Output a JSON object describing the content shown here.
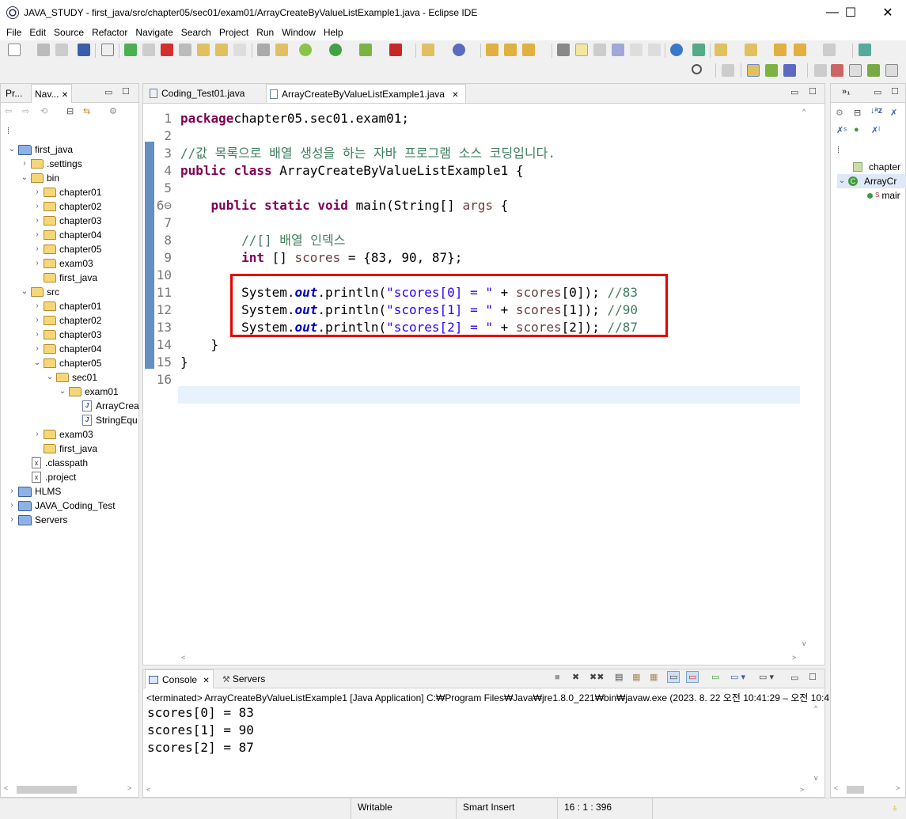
{
  "window": {
    "title": "JAVA_STUDY - first_java/src/chapter05/sec01/exam01/ArrayCreateByValueListExample1.java - Eclipse IDE",
    "minimize": "—",
    "maximize": "☐",
    "close": "✕"
  },
  "menu": [
    "File",
    "Edit",
    "Source",
    "Refactor",
    "Navigate",
    "Search",
    "Project",
    "Run",
    "Window",
    "Help"
  ],
  "nav_panel": {
    "tabs": [
      {
        "label": "Pr..."
      },
      {
        "label": "Nav..."
      }
    ],
    "tree": [
      {
        "label": "first_java",
        "depth": 0,
        "expanded": true,
        "kind": "project"
      },
      {
        "label": ".settings",
        "depth": 1,
        "expanded": false,
        "kind": "folder"
      },
      {
        "label": "bin",
        "depth": 1,
        "expanded": true,
        "kind": "folder"
      },
      {
        "label": "chapter01",
        "depth": 2,
        "expanded": false,
        "kind": "folder"
      },
      {
        "label": "chapter02",
        "depth": 2,
        "expanded": false,
        "kind": "folder"
      },
      {
        "label": "chapter03",
        "depth": 2,
        "expanded": false,
        "kind": "folder"
      },
      {
        "label": "chapter04",
        "depth": 2,
        "expanded": false,
        "kind": "folder"
      },
      {
        "label": "chapter05",
        "depth": 2,
        "expanded": false,
        "kind": "folder"
      },
      {
        "label": "exam03",
        "depth": 2,
        "expanded": false,
        "kind": "folder"
      },
      {
        "label": "first_java",
        "depth": 2,
        "expanded": null,
        "kind": "folder"
      },
      {
        "label": "src",
        "depth": 1,
        "expanded": true,
        "kind": "folder"
      },
      {
        "label": "chapter01",
        "depth": 2,
        "expanded": false,
        "kind": "folder"
      },
      {
        "label": "chapter02",
        "depth": 2,
        "expanded": false,
        "kind": "folder"
      },
      {
        "label": "chapter03",
        "depth": 2,
        "expanded": false,
        "kind": "folder"
      },
      {
        "label": "chapter04",
        "depth": 2,
        "expanded": false,
        "kind": "folder"
      },
      {
        "label": "chapter05",
        "depth": 2,
        "expanded": true,
        "kind": "folder"
      },
      {
        "label": "sec01",
        "depth": 3,
        "expanded": true,
        "kind": "folder"
      },
      {
        "label": "exam01",
        "depth": 4,
        "expanded": true,
        "kind": "folder"
      },
      {
        "label": "ArrayCrea",
        "depth": 5,
        "expanded": null,
        "kind": "java"
      },
      {
        "label": "StringEqu",
        "depth": 5,
        "expanded": null,
        "kind": "java"
      },
      {
        "label": "exam03",
        "depth": 2,
        "expanded": false,
        "kind": "folder"
      },
      {
        "label": "first_java",
        "depth": 2,
        "expanded": null,
        "kind": "folder"
      },
      {
        "label": ".classpath",
        "depth": 1,
        "expanded": null,
        "kind": "xml"
      },
      {
        "label": ".project",
        "depth": 1,
        "expanded": null,
        "kind": "xml"
      },
      {
        "label": "HLMS",
        "depth": 0,
        "expanded": false,
        "kind": "project"
      },
      {
        "label": "JAVA_Coding_Test",
        "depth": 0,
        "expanded": false,
        "kind": "project"
      },
      {
        "label": "Servers",
        "depth": 0,
        "expanded": false,
        "kind": "project"
      }
    ]
  },
  "editor": {
    "tabs": [
      {
        "label": "Coding_Test01.java",
        "active": false
      },
      {
        "label": "ArrayCreateByValueListExample1.java",
        "active": true
      }
    ],
    "lines": [
      {
        "n": "1",
        "parts": [
          [
            "kw",
            "package"
          ],
          [
            "",
            "chapter05.sec01.exam01;"
          ]
        ]
      },
      {
        "n": "2",
        "parts": []
      },
      {
        "n": "3",
        "parts": [
          [
            "cm",
            "//값 목록으로 배열 생성을 하는 자바 프로그램 소스 코딩입니다."
          ]
        ]
      },
      {
        "n": "4",
        "parts": [
          [
            "kw",
            "public"
          ],
          [
            "",
            " "
          ],
          [
            "kw",
            "class"
          ],
          [
            "",
            " ArrayCreateByValueListExample1 {"
          ]
        ]
      },
      {
        "n": "5",
        "parts": []
      },
      {
        "n": "6⊖",
        "parts": [
          [
            "",
            "    "
          ],
          [
            "kw",
            "public"
          ],
          [
            "",
            " "
          ],
          [
            "kw",
            "static"
          ],
          [
            "",
            " "
          ],
          [
            "kw",
            "void"
          ],
          [
            "",
            " main(String[] "
          ],
          [
            "var",
            "args"
          ],
          [
            "",
            " {"
          ]
        ]
      },
      {
        "n": "7",
        "parts": []
      },
      {
        "n": "8",
        "parts": [
          [
            "",
            "        "
          ],
          [
            "cm",
            "//[] 배열 인덱스"
          ]
        ]
      },
      {
        "n": "9",
        "parts": [
          [
            "",
            "        "
          ],
          [
            "kw",
            "int"
          ],
          [
            "",
            " [] "
          ],
          [
            "var",
            "scores"
          ],
          [
            "",
            " = {83, 90, 87};"
          ]
        ]
      },
      {
        "n": "10",
        "parts": []
      },
      {
        "n": "11",
        "parts": [
          [
            "",
            "        System."
          ],
          [
            "fld",
            "out"
          ],
          [
            "",
            ".println("
          ],
          [
            "str",
            "\"scores[0] = \""
          ],
          [
            "",
            " + "
          ],
          [
            "var",
            "scores"
          ],
          [
            "",
            "[0]); "
          ],
          [
            "cm",
            "//83"
          ]
        ]
      },
      {
        "n": "12",
        "parts": [
          [
            "",
            "        System."
          ],
          [
            "fld",
            "out"
          ],
          [
            "",
            ".println("
          ],
          [
            "str",
            "\"scores[1] = \""
          ],
          [
            "",
            " + "
          ],
          [
            "var",
            "scores"
          ],
          [
            "",
            "[1]); "
          ],
          [
            "cm",
            "//90"
          ]
        ]
      },
      {
        "n": "13",
        "parts": [
          [
            "",
            "        System."
          ],
          [
            "fld",
            "out"
          ],
          [
            "",
            ".println("
          ],
          [
            "str",
            "\"scores[2] = \""
          ],
          [
            "",
            " + "
          ],
          [
            "var",
            "scores"
          ],
          [
            "",
            "[2]); "
          ],
          [
            "cm",
            "//87"
          ]
        ]
      },
      {
        "n": "14",
        "parts": [
          [
            "",
            "    }"
          ]
        ]
      },
      {
        "n": "15",
        "parts": [
          [
            "",
            "}"
          ]
        ]
      },
      {
        "n": "16",
        "parts": []
      }
    ]
  },
  "outline": {
    "items": [
      {
        "label": "chapter"
      },
      {
        "label": "ArrayCr"
      },
      {
        "label": "mair"
      }
    ]
  },
  "console": {
    "tabs": [
      {
        "label": "Console"
      },
      {
        "label": "Servers"
      }
    ],
    "header": "<terminated> ArrayCreateByValueListExample1 [Java Application] C:₩Program Files₩Java₩jre1.8.0_221₩bin₩javaw.exe  (2023. 8. 22 오전 10:41:29 – 오전 10:4",
    "output": [
      "scores[0] = 83",
      "scores[1] = 90",
      "scores[2] = 87"
    ]
  },
  "status": {
    "writable": "Writable",
    "insert_mode": "Smart Insert",
    "position": "16 : 1 : 396"
  }
}
